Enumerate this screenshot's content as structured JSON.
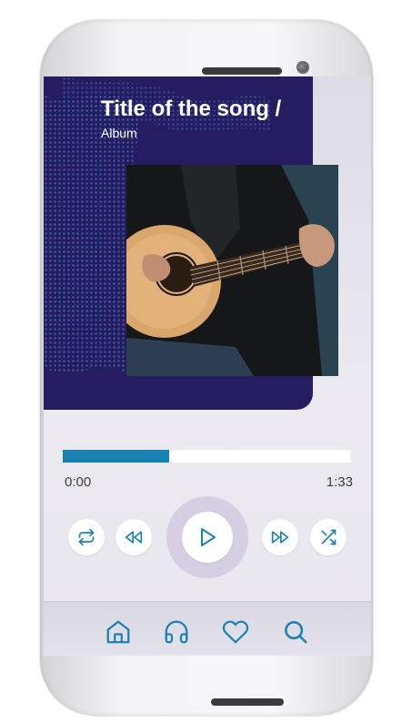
{
  "now_playing": {
    "title": "Title of the song /",
    "album": "Album"
  },
  "player": {
    "elapsed": "0:00",
    "duration": "1:33",
    "progress_fraction": 0.37
  },
  "controls": {
    "repeat": "repeat-icon",
    "rewind": "rewind-icon",
    "play": "play-icon",
    "fast_forward": "fast-forward-icon",
    "shuffle": "shuffle-icon"
  },
  "nav": {
    "items": [
      "home-icon",
      "headphones-icon",
      "heart-icon",
      "search-icon"
    ]
  },
  "colors": {
    "cover_bg": "#261c62",
    "accent": "#1a82b3",
    "icon": "#1a82b3",
    "play_ring": "#d6cfe3"
  }
}
